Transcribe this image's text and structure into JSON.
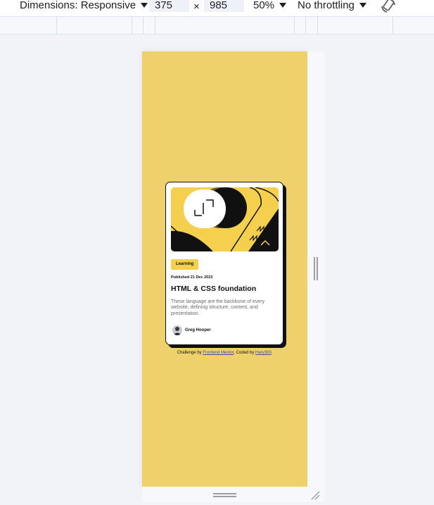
{
  "devtools": {
    "dimensions_label": "Dimensions: Responsive",
    "width_value": "375",
    "times_symbol": "×",
    "height_value": "985",
    "zoom_label": "50%",
    "throttling_label": "No throttling",
    "icons": [
      "caret-down-icon",
      "rotate-icon",
      "resize-handle-icon",
      "corner-resize-icon"
    ]
  },
  "page": {
    "background_color": "#eed16a",
    "card": {
      "badge": "Learning",
      "published": "Published 21 Dec 2023",
      "title": "HTML & CSS foundation",
      "description": "These language are the backbone of every website, defining structure, content, and presentation.",
      "author": "Greg Hooper",
      "accent_color": "#f4d04e"
    },
    "attribution": {
      "prefix": "Challenge by ",
      "link1": "Frontend Mentor",
      "middle": ". Coded by ",
      "link2": "Hary300",
      "suffix": "."
    }
  }
}
